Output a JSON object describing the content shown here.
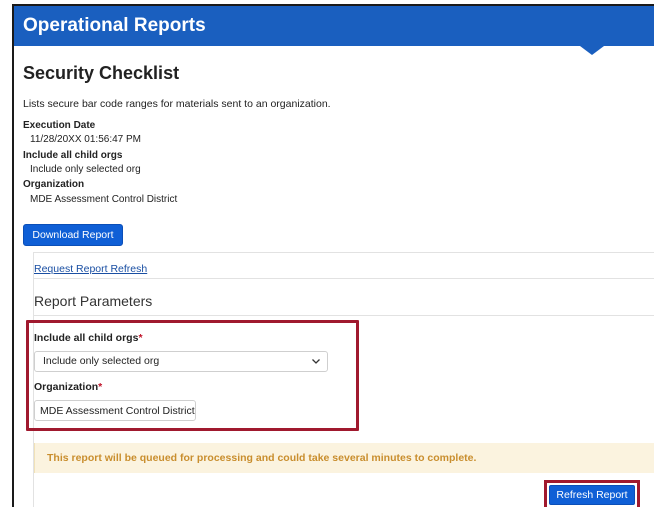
{
  "header": {
    "title": "Operational Reports"
  },
  "page": {
    "title": "Security Checklist",
    "description": "Lists secure bar code ranges for materials sent to an organization."
  },
  "info": {
    "execution_date_label": "Execution Date",
    "execution_date_value": "11/28/20XX 01:56:47 PM",
    "child_orgs_label": "Include all child orgs",
    "child_orgs_value": "Include only selected org",
    "organization_label": "Organization",
    "organization_value": "MDE Assessment Control District"
  },
  "buttons": {
    "download_label": "Download Report",
    "refresh_label": "Refresh Report"
  },
  "panel": {
    "refresh_link": "Request Report Refresh",
    "params_title": "Report Parameters"
  },
  "form": {
    "child_orgs_label": "Include all child orgs",
    "child_orgs_selected": "Include only selected org",
    "organization_label": "Organization",
    "organization_value": "MDE Assessment Control District",
    "required_mark": "*"
  },
  "alert": {
    "text": "This report will be queued for processing and could take several minutes to complete."
  },
  "colors": {
    "header": "#1a5fbf",
    "button": "#0f5fd6",
    "highlight": "#a0192e",
    "alert_bg": "#fbf3df",
    "alert_text": "#c98e2e"
  },
  "icons": {
    "select_chevron": "chevron-down-icon"
  }
}
